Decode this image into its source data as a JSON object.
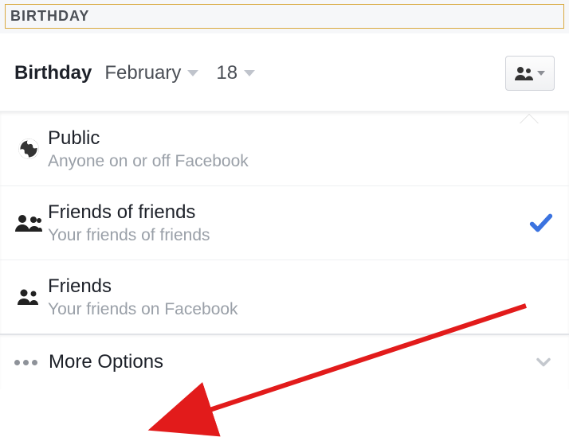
{
  "header": {
    "label": "BIRTHDAY"
  },
  "birthday": {
    "field_label": "Birthday",
    "month": "February",
    "day": "18"
  },
  "menu": {
    "items": [
      {
        "title": "Public",
        "subtitle": "Anyone on or off Facebook",
        "selected": false
      },
      {
        "title": "Friends of friends",
        "subtitle": "Your friends of friends",
        "selected": true
      },
      {
        "title": "Friends",
        "subtitle": "Your friends on Facebook",
        "selected": false
      }
    ],
    "more_label": "More Options"
  }
}
